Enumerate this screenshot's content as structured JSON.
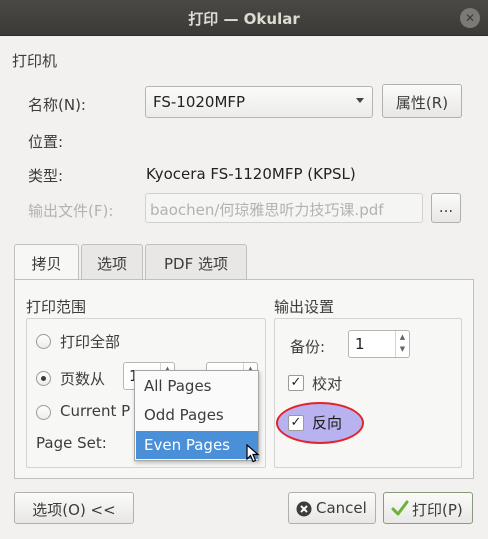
{
  "window": {
    "title": "打印 — Okular",
    "close_glyph": "✕"
  },
  "printer": {
    "section_title": "打印机",
    "name_label": "名称(N):",
    "name_value": "FS-1020MFP",
    "properties_button": "属性(R)",
    "location_label": "位置:",
    "location_value": "",
    "type_label": "类型:",
    "type_value": "Kyocera FS-1120MFP (KPSL)",
    "output_file_label": "输出文件(F):",
    "output_file_value": "baochen/何琼雅思听力技巧课.pdf",
    "browse_button": "..."
  },
  "tabs": [
    {
      "label": "拷贝",
      "active": true
    },
    {
      "label": "选项",
      "active": false
    },
    {
      "label": "PDF 选项",
      "active": false
    }
  ],
  "print_range": {
    "title": "打印范围",
    "all_pages": "打印全部",
    "pages_from": "页数从",
    "pages_from_value": "1",
    "current_page": "Current P",
    "page_set_label": "Page Set:"
  },
  "output_settings": {
    "title": "输出设置",
    "copies_label": "备份:",
    "copies_value": "1",
    "collate_label": "校对",
    "collate_checked": true,
    "reverse_label": "反向",
    "reverse_checked": true,
    "check_glyph": "✓"
  },
  "page_set_dropdown": {
    "options": [
      "All Pages",
      "Odd Pages",
      "Even Pages"
    ],
    "selected": "Even Pages"
  },
  "footer": {
    "options_button": "选项(O) <<",
    "cancel_button": "Cancel",
    "print_button": "打印(P)"
  },
  "colors": {
    "selection": "#4a90d9",
    "highlight_ring": "#e0252b",
    "highlight_fill": "#b9b2f0",
    "titlebar": "#3b3a36"
  },
  "icons": {
    "cancel": "cancel-x-icon",
    "print": "checkmark-icon",
    "dropdown": "chevron-down-icon"
  }
}
